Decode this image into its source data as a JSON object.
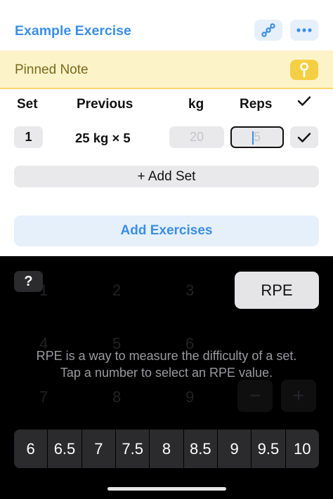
{
  "exercise": {
    "title": "Example Exercise",
    "link_icon": "link-chain-icon",
    "more_icon": "more-dots-icon"
  },
  "pinned_note": {
    "label": "Pinned Note",
    "pin_icon": "pin-icon"
  },
  "columns": {
    "set": "Set",
    "previous": "Previous",
    "kg": "kg",
    "reps": "Reps",
    "done_icon": "checkmark-icon"
  },
  "sets": [
    {
      "number": "1",
      "previous": "25 kg × 5",
      "kg_placeholder": "20",
      "reps_placeholder": "5",
      "done_icon": "checkmark-icon"
    }
  ],
  "add_set_label": "+ Add Set",
  "add_exercises_label": "Add Exercises",
  "keypad": {
    "help_label": "?",
    "rpe_button_label": "RPE",
    "background_keys": [
      "1",
      "2",
      "3",
      "4",
      "5",
      "6",
      "7",
      "8",
      "9"
    ],
    "minus_label": "−",
    "plus_label": "+",
    "info_line1": "RPE is a way to measure the difficulty of a set.",
    "info_line2": "Tap a number to select an RPE value.",
    "rpe_values": [
      "6",
      "6.5",
      "7",
      "7.5",
      "8",
      "8.5",
      "9",
      "9.5",
      "10"
    ]
  },
  "colors": {
    "accent": "#3a8ee6",
    "pinned_bg": "#fdf3c8",
    "pin_button": "#f5cf43",
    "keypad_bg": "#000000",
    "option_bg": "#2b2b2e"
  }
}
